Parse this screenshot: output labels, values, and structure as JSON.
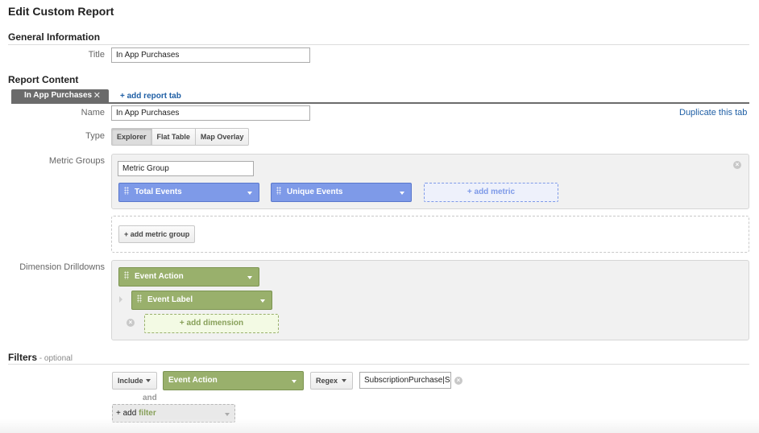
{
  "page": {
    "title": "Edit Custom Report"
  },
  "general": {
    "section_title": "General Information",
    "title_label": "Title",
    "title_value": "In App Purchases"
  },
  "report_content": {
    "section_title": "Report Content",
    "tabs": [
      {
        "label": "In App Purchases",
        "close_glyph": "✕"
      }
    ],
    "add_tab_label": "+ add report tab",
    "duplicate_label": "Duplicate this tab",
    "name_label": "Name",
    "name_value": "In App Purchases",
    "type_label": "Type",
    "types": [
      {
        "label": "Explorer",
        "active": true
      },
      {
        "label": "Flat Table",
        "active": false
      },
      {
        "label": "Map Overlay",
        "active": false
      }
    ],
    "metric_groups_label": "Metric Groups",
    "metric_group": {
      "name_value": "Metric Group",
      "metrics": [
        {
          "label": "Total Events"
        },
        {
          "label": "Unique Events"
        }
      ],
      "add_metric_label": "+ add metric"
    },
    "add_metric_group_label": "+ add metric group",
    "dimension_label": "Dimension Drilldowns",
    "dimensions": [
      {
        "label": "Event Action"
      },
      {
        "label": "Event Label"
      }
    ],
    "add_dimension_label": "+ add dimension"
  },
  "filters": {
    "section_title": "Filters",
    "optional_label": " - optional",
    "rule": {
      "include_label": "Include",
      "dimension_label": "Event Action",
      "match_label": "Regex",
      "value": "SubscriptionPurchase|Si"
    },
    "and_label": "and",
    "add_filter_prefix": "+ add ",
    "add_filter_word": "filter"
  },
  "colors": {
    "metric_chip": "#7e9ae8",
    "dimension_chip": "#99b06c",
    "link": "#1f5fa5",
    "tab_active": "#6b6b6b"
  },
  "icons": [
    "close-icon",
    "remove-icon",
    "drag-handle-icon",
    "chevron-down-icon",
    "expand-arrow-icon"
  ]
}
